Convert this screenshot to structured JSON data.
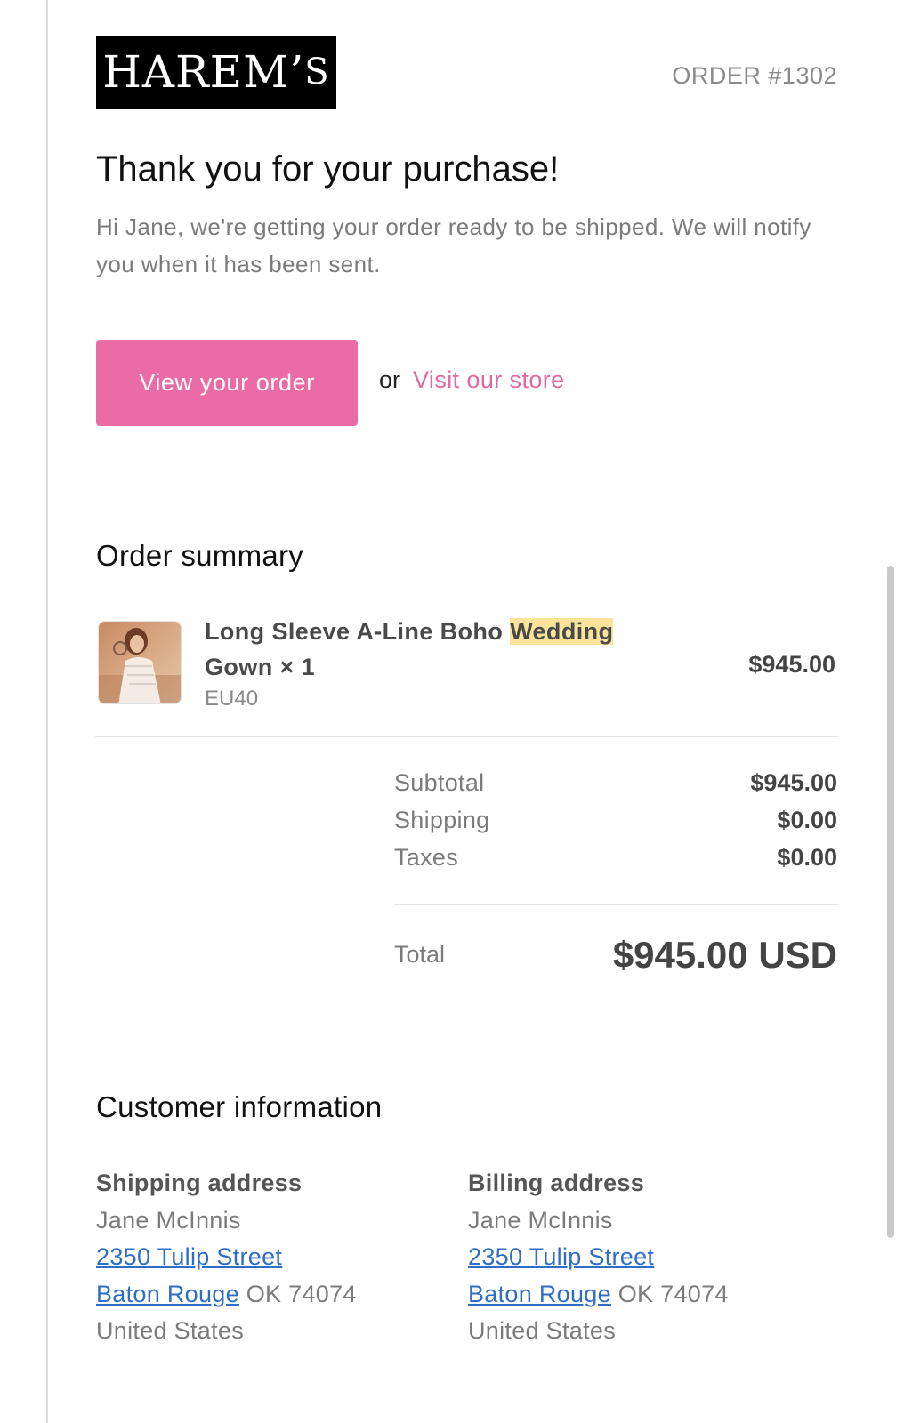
{
  "header": {
    "logo": {
      "big_letters": "H",
      "mid_letters": "AREM",
      "apostrophe": "’",
      "small_letter": "S"
    },
    "order_number": "ORDER #1302"
  },
  "intro": {
    "title": "Thank you for your purchase!",
    "message": "Hi Jane, we're getting your order ready to be shipped. We will notify you when it has been sent."
  },
  "actions": {
    "view_order": "View your order",
    "or": "or",
    "visit_store": "Visit our store"
  },
  "summary": {
    "heading": "Order summary",
    "item": {
      "name_prefix": "Long Sleeve A-Line Boho ",
      "name_highlight": "Wedding",
      "name_suffix": " Gown × 1",
      "variant": "EU40",
      "price": "$945.00"
    },
    "subtotal": {
      "label": "Subtotal",
      "value": "$945.00"
    },
    "shipping": {
      "label": "Shipping",
      "value": "$0.00"
    },
    "taxes": {
      "label": "Taxes",
      "value": "$0.00"
    },
    "total": {
      "label": "Total",
      "value": "$945.00 USD"
    }
  },
  "customer": {
    "heading": "Customer information",
    "shipping": {
      "heading": "Shipping address",
      "name": "Jane McInnis",
      "street": "2350 Tulip Street",
      "city": "Baton Rouge",
      "state_zip": " OK 74074",
      "country": "United States"
    },
    "billing": {
      "heading": "Billing address",
      "name": "Jane McInnis",
      "street": "2350 Tulip Street",
      "city": "Baton Rouge",
      "state_zip": " OK 74074",
      "country": "United States"
    }
  },
  "colors": {
    "accent_pink": "#ea6ba5",
    "link_pink": "#e06aa1",
    "link_blue": "#2f6ec7",
    "highlight": "#fbe39a"
  },
  "icons": {
    "product_thumbnail": "wedding-gown-photo"
  }
}
